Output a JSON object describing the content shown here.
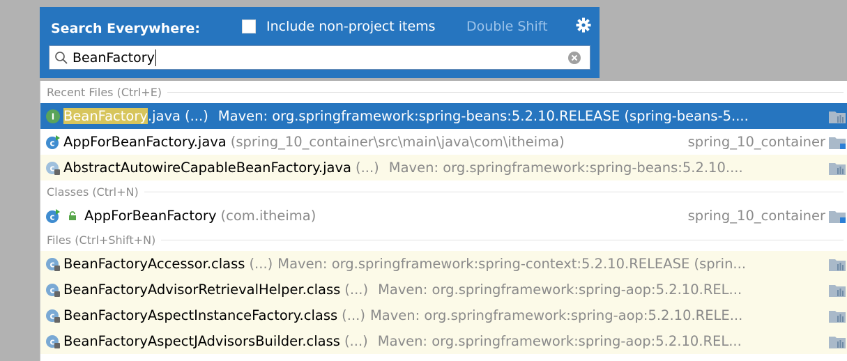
{
  "header": {
    "title": "Search Everywhere:",
    "include_label": "Include non-project items",
    "shortcut_hint": "Double Shift",
    "include_checked": false
  },
  "search": {
    "value": "BeanFactory"
  },
  "groups": {
    "recent": "Recent Files (Ctrl+E)",
    "classes": "Classes (Ctrl+N)",
    "files": "Files (Ctrl+Shift+N)"
  },
  "recent": [
    {
      "highlight": "BeanFactory",
      "name_rest": ".java",
      "paren": "(...)",
      "location": "Maven: org.springframework:spring-beans:5.2.10.RELEASE (spring-beans-5....",
      "icon": "interface-icon",
      "selected": true
    },
    {
      "name": "AppForBeanFactory.java",
      "paren": "(spring_10_container\\src\\main\\java\\com\\itheima)",
      "module": "spring_10_container",
      "icon": "class-runnable-icon"
    },
    {
      "name": "AbstractAutowireCapableBeanFactory.java",
      "paren": "(...)",
      "location": "Maven: org.springframework:spring-beans:5.2.10....",
      "icon": "abstract-class-icon"
    }
  ],
  "classes": [
    {
      "name": "AppForBeanFactory",
      "paren": "(com.itheima)",
      "module": "spring_10_container",
      "icon": "class-runnable-icon"
    }
  ],
  "files": [
    {
      "name": "BeanFactoryAccessor.class",
      "paren": "(...)",
      "location": "Maven: org.springframework:spring-context:5.2.10.RELEASE (sprin..."
    },
    {
      "name": "BeanFactoryAdvisorRetrievalHelper.class",
      "paren": "(...)",
      "location": "Maven: org.springframework:spring-aop:5.2.10.REL..."
    },
    {
      "name": "BeanFactoryAspectInstanceFactory.class",
      "paren": "(...)",
      "location": "Maven: org.springframework:spring-aop:5.2.10.RELE..."
    },
    {
      "name": "BeanFactoryAspectJAdvisorsBuilder.class",
      "paren": "(...)",
      "location": "Maven: org.springframework:spring-aop:5.2.10.REL..."
    }
  ],
  "colors": {
    "header_bg": "#2675bf",
    "selection_bg": "#2675bf",
    "library_row_bg": "#fcfae8",
    "match_highlight": "#d7c55c"
  }
}
